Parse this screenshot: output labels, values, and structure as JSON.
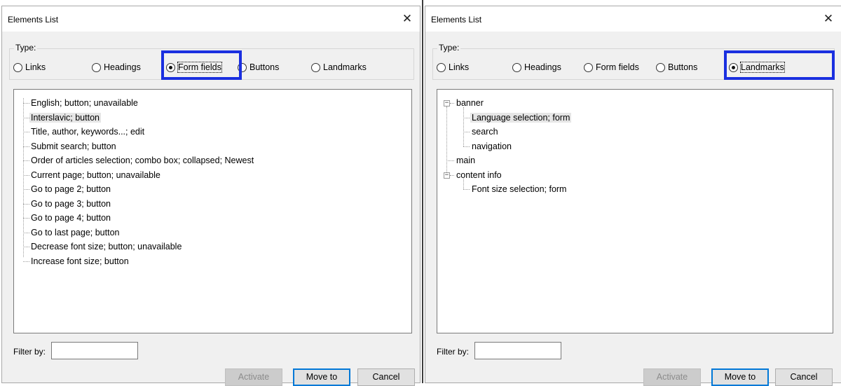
{
  "left": {
    "title": "Elements List",
    "close_glyph": "✕",
    "type_label": "Type:",
    "radios": [
      {
        "label": "Links",
        "checked": false
      },
      {
        "label": "Headings",
        "checked": false
      },
      {
        "label": "Form fields",
        "checked": true
      },
      {
        "label": "Buttons",
        "checked": false
      },
      {
        "label": "Landmarks",
        "checked": false
      }
    ],
    "items": [
      "English; button; unavailable",
      "Interslavic; button",
      "Title, author, keywords...; edit",
      "Submit search; button",
      "Order of articles selection; combo box; collapsed; Newest",
      "Current page; button; unavailable",
      "Go to page 2; button",
      "Go to page 3; button",
      "Go to page 4; button",
      "Go to last page; button",
      "Decrease font size; button; unavailable",
      "Increase font size; button"
    ],
    "selected_item": "Interslavic; button",
    "filter_label": "Filter by:",
    "filter_value": "",
    "buttons": {
      "activate": "Activate",
      "move_to": "Move to",
      "cancel": "Cancel"
    }
  },
  "right": {
    "title": "Elements List",
    "close_glyph": "✕",
    "type_label": "Type:",
    "radios": [
      {
        "label": "Links",
        "checked": false
      },
      {
        "label": "Headings",
        "checked": false
      },
      {
        "label": "Form fields",
        "checked": false
      },
      {
        "label": "Buttons",
        "checked": false
      },
      {
        "label": "Landmarks",
        "checked": true
      }
    ],
    "tree": [
      {
        "label": "banner",
        "expanded": true,
        "children": [
          "Language selection; form",
          "search",
          "navigation"
        ]
      },
      {
        "label": "main",
        "expanded": false,
        "children": []
      },
      {
        "label": "content info",
        "expanded": true,
        "children": [
          "Font size selection; form"
        ]
      }
    ],
    "selected_item": "Language selection; form",
    "filter_label": "Filter by:",
    "filter_value": "",
    "buttons": {
      "activate": "Activate",
      "move_to": "Move to",
      "cancel": "Cancel"
    }
  },
  "colors": {
    "highlight_box": "#1a2fe0",
    "dialog_bg": "#f0f0f0"
  },
  "icons": {
    "close": "close-icon",
    "expander": "collapse-icon"
  }
}
